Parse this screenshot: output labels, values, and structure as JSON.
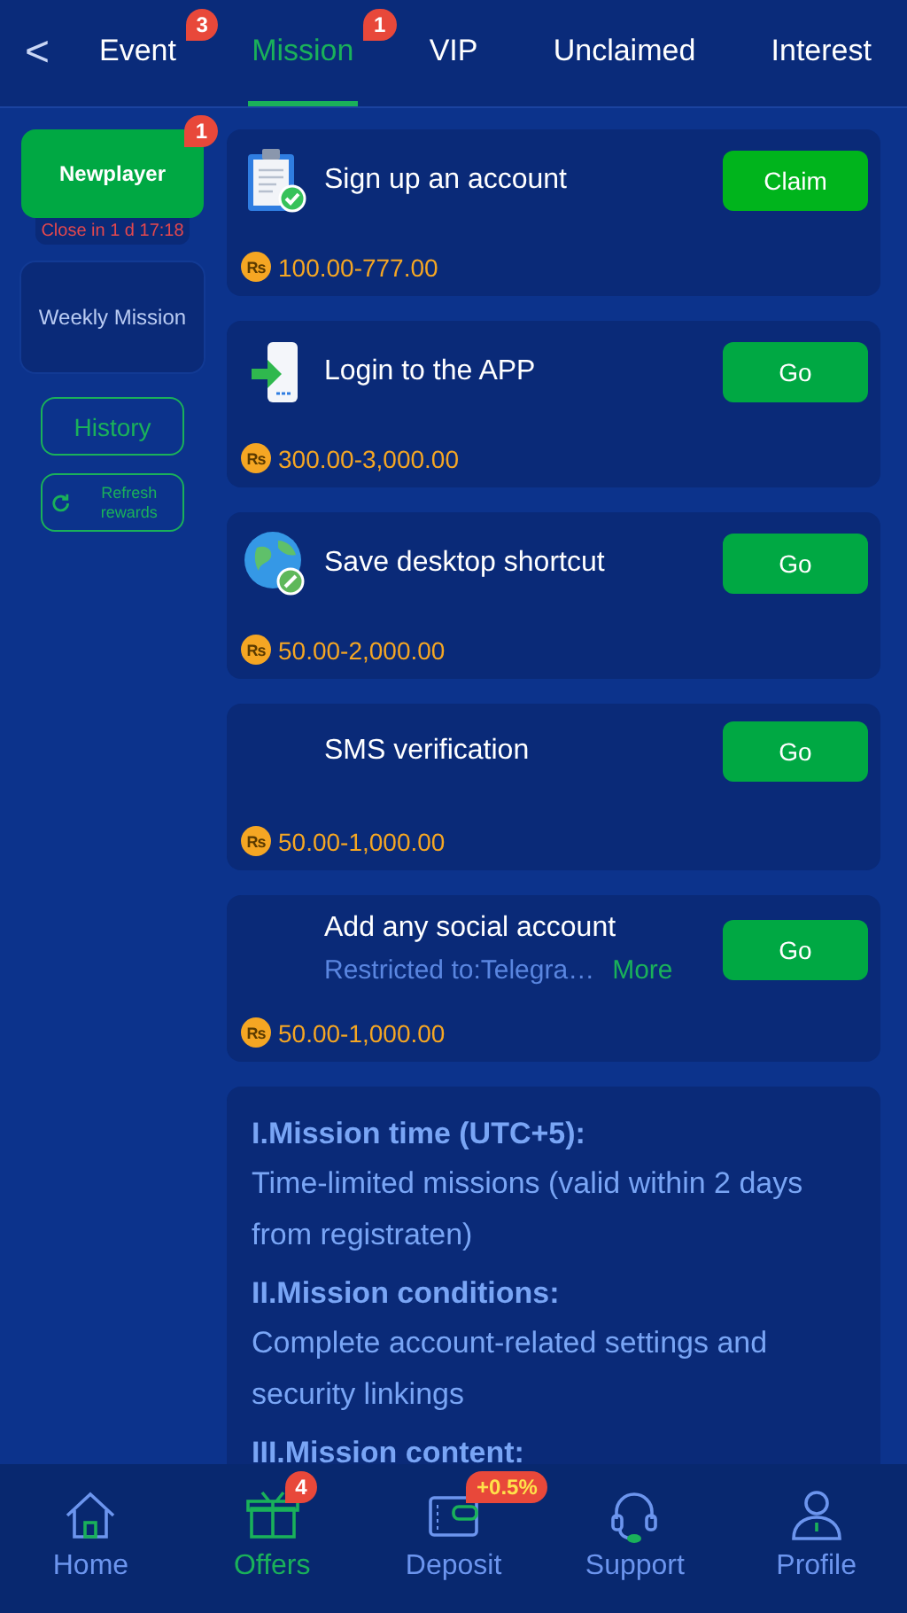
{
  "header": {
    "back": "<"
  },
  "tabs": [
    {
      "label": "Event",
      "selected": false,
      "badge": "3"
    },
    {
      "label": "Mission",
      "selected": true,
      "badge": "1"
    },
    {
      "label": "VIP",
      "selected": false
    },
    {
      "label": "Unclaimed",
      "selected": false
    },
    {
      "label": "Interest",
      "selected": false
    }
  ],
  "sidebar": {
    "categories": [
      {
        "label": "Newplayer",
        "selected": true,
        "badge": "1",
        "countdown": "Close in 1 d 17:18"
      },
      {
        "label": "Weekly Mission",
        "selected": false
      }
    ],
    "history_button": "History",
    "refresh_button": "Refresh rewards"
  },
  "missions": [
    {
      "title": "Sign up an account",
      "currency": "Rs",
      "reward": "100.00-777.00",
      "action": "Claim",
      "claimable": true
    },
    {
      "title": "Login to the APP",
      "currency": "Rs",
      "reward": "300.00-3,000.00",
      "action": "Go",
      "claimable": false
    },
    {
      "title": "Save desktop shortcut",
      "currency": "Rs",
      "reward": "50.00-2,000.00",
      "action": "Go",
      "claimable": false
    },
    {
      "title": "SMS verification",
      "currency": "Rs",
      "reward": "50.00-1,000.00",
      "action": "Go",
      "claimable": false
    },
    {
      "title": "Add any social account",
      "subtitle": "Restricted to:Telegra…",
      "more": "More",
      "currency": "Rs",
      "reward": "50.00-1,000.00",
      "action": "Go",
      "claimable": false
    }
  ],
  "rules": [
    {
      "kind": "heading",
      "text": "I.Mission time (UTC+5):"
    },
    {
      "kind": "text",
      "text": "Time-limited missions (valid within 2 days from registraten)"
    },
    {
      "kind": "heading",
      "text": "II.Mission conditions:"
    },
    {
      "kind": "text",
      "text": "Complete account-related settings and security linkings"
    },
    {
      "kind": "heading",
      "text": "III.Mission content:"
    }
  ],
  "nav": [
    {
      "label": "Home",
      "selected": false
    },
    {
      "label": "Offers",
      "selected": true,
      "badge": "4"
    },
    {
      "label": "Deposit",
      "selected": false,
      "badge": "+0.5%"
    },
    {
      "label": "Support",
      "selected": false
    },
    {
      "label": "Profile",
      "selected": false
    }
  ]
}
